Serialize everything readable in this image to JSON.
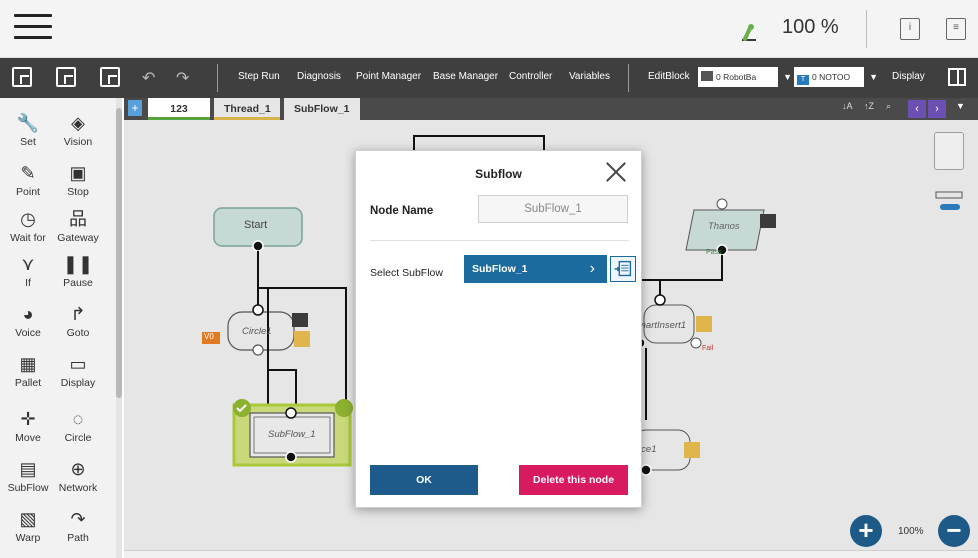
{
  "status": {
    "speed": "100 %"
  },
  "toolbar": {
    "step_run": "Step Run",
    "diagnosis": "Diagnosis",
    "point_manager": "Point Manager",
    "base_manager": "Base Manager",
    "controller": "Controller",
    "variables": "Variables",
    "edit_block": "EditBlock",
    "base_select": "0 RobotBa",
    "tool_select": "0 NOTOO",
    "display": "Display"
  },
  "palette": {
    "items": [
      {
        "label": "Set",
        "icon": "wrench-icon"
      },
      {
        "label": "Vision",
        "icon": "eye-icon"
      },
      {
        "label": "Point",
        "icon": "point-icon"
      },
      {
        "label": "Stop",
        "icon": "stop-icon"
      },
      {
        "label": "Wait for",
        "icon": "clock-icon"
      },
      {
        "label": "Gateway",
        "icon": "gateway-icon"
      },
      {
        "label": "If",
        "icon": "branch-icon"
      },
      {
        "label": "Pause",
        "icon": "pause-icon"
      },
      {
        "label": "Voice",
        "icon": "voice-icon"
      },
      {
        "label": "Goto",
        "icon": "goto-icon"
      },
      {
        "label": "Pallet",
        "icon": "grid-icon"
      },
      {
        "label": "Display",
        "icon": "display-icon"
      },
      {
        "label": "Move",
        "icon": "move-icon"
      },
      {
        "label": "Circle",
        "icon": "circle-icon"
      },
      {
        "label": "SubFlow",
        "icon": "subflow-icon"
      },
      {
        "label": "Network",
        "icon": "globe-icon"
      },
      {
        "label": "Warp",
        "icon": "warp-icon"
      },
      {
        "label": "Path",
        "icon": "path-icon"
      }
    ]
  },
  "tabs": [
    {
      "label": "123"
    },
    {
      "label": "Thread_1"
    },
    {
      "label": "SubFlow_1"
    }
  ],
  "flow": {
    "start_label": "Start",
    "circle_label": "Circle1",
    "circle_badge": "V0",
    "subflow_label": "SubFlow_1",
    "thanos_label": "Thanos",
    "pass_label": "Pass",
    "smart_insert_label": "martInsert1",
    "fail_label": "Fail",
    "force_label": "rce1"
  },
  "zoom": {
    "level": "100%"
  },
  "dialog": {
    "title": "Subflow",
    "node_name_label": "Node Name",
    "node_name_value": "SubFlow_1",
    "select_subflow_label": "Select SubFlow",
    "select_subflow_value": "SubFlow_1",
    "ok_label": "OK",
    "delete_label": "Delete this node"
  },
  "colors": {
    "toolbar_bg": "#3f3f3f",
    "subflow_button": "#1c6b9f",
    "ok_button": "#1c5b8a",
    "delete_button": "#d81b60",
    "active_node_green": "#a9c83a"
  }
}
